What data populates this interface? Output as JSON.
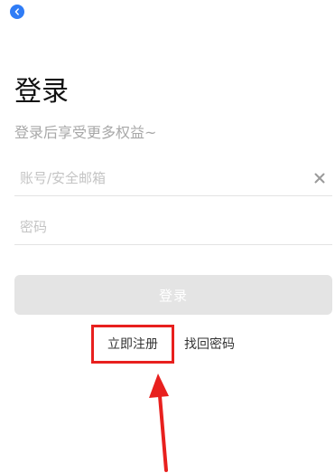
{
  "header": {
    "back_icon": "chevron-left-icon",
    "accent": "#2f7cf6"
  },
  "login": {
    "title": "登录",
    "subtitle": "登录后享受更多权益~",
    "account_placeholder": "账号/安全邮箱",
    "account_value": "",
    "password_placeholder": "密码",
    "password_value": "",
    "clear_icon": "close-icon",
    "login_button": "登录",
    "register_link": "立即注册",
    "forgot_link": "找回密码"
  },
  "annotation": {
    "highlight_color": "#e8201e"
  }
}
